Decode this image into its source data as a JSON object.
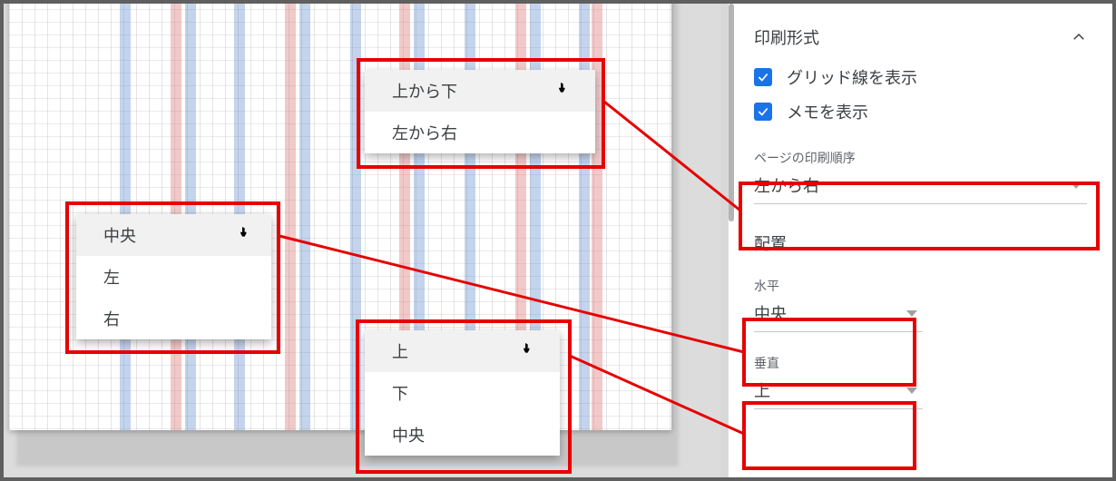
{
  "panel": {
    "section_title": "印刷形式",
    "checkbox_gridlines": "グリッド線を表示",
    "checkbox_notes": "メモを表示",
    "page_order": {
      "label": "ページの印刷順序",
      "value": "左から右",
      "options": [
        "上から下",
        "左から右"
      ]
    },
    "alignment_heading": "配置",
    "horizontal": {
      "label": "水平",
      "value": "中央",
      "options": [
        "中央",
        "左",
        "右"
      ]
    },
    "vertical": {
      "label": "垂直",
      "value": "上",
      "options": [
        "上",
        "下",
        "中央"
      ]
    }
  },
  "popups": {
    "order": {
      "items": [
        "上から下",
        "左から右"
      ],
      "hover_index": 0
    },
    "horiz": {
      "items": [
        "中央",
        "左",
        "右"
      ],
      "hover_index": 0
    },
    "vert": {
      "items": [
        "上",
        "下",
        "中央"
      ],
      "hover_index": 0
    }
  },
  "colors": {
    "accent": "#1a73e8",
    "annotation": "#e60000"
  }
}
